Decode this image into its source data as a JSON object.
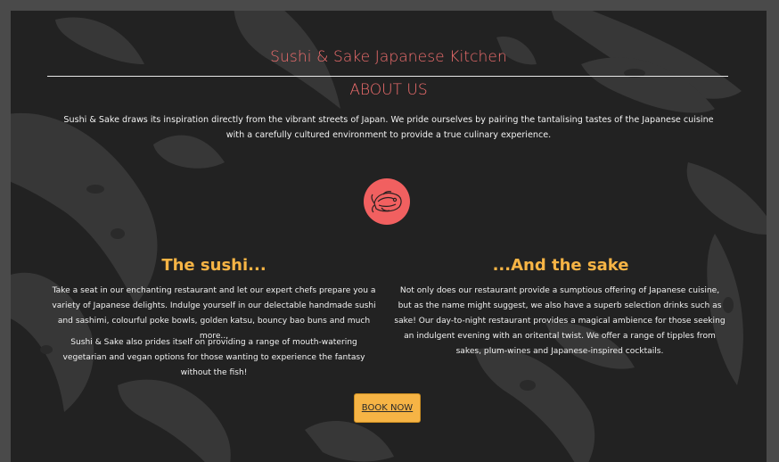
{
  "header": {
    "site_title": "Sushi & Sake Japanese Kitchen"
  },
  "about": {
    "heading": "ABOUT US",
    "text": "Sushi & Sake draws its inspiration directly from the vibrant streets of Japan. We pride ourselves by pairing the tantalising tastes of the Japanese cuisine with a carefully cultured environment to provide a true culinary experience."
  },
  "logo": {
    "icon": "fish-logo-icon",
    "color": "#f16060"
  },
  "sushi": {
    "heading": "The sushi...",
    "p1": "Take a seat in our enchanting restaurant and let our expert chefs prepare you a variety of Japanese delights. Indulge yourself in our delectable handmade sushi and sashimi, colourful poke bowls, golden katsu, bouncy bao buns and much more...",
    "p2": "Sushi & Sake also prides itself on providing a range of mouth-watering vegetarian and vegan options for those wanting to experience the fantasy without the fish!"
  },
  "sake": {
    "heading": "...And the sake",
    "p1": "Not only does our restaurant provide a sumptious offering of Japanese cuisine, but as the name might suggest, we also have a superb selection drinks such as sake! Our day-to-night restaurant provides a magical ambience for those seeking an indulgent evening with an oritental twist. We offer a range of tipples from sakes, plum-wines and Japanese-inspired cocktails."
  },
  "cta": {
    "label": "BOOK NOW"
  },
  "colors": {
    "background": "#222222",
    "accent_red": "#f36f6f",
    "accent_orange": "#f6b445",
    "border": "#4a4a4a"
  }
}
